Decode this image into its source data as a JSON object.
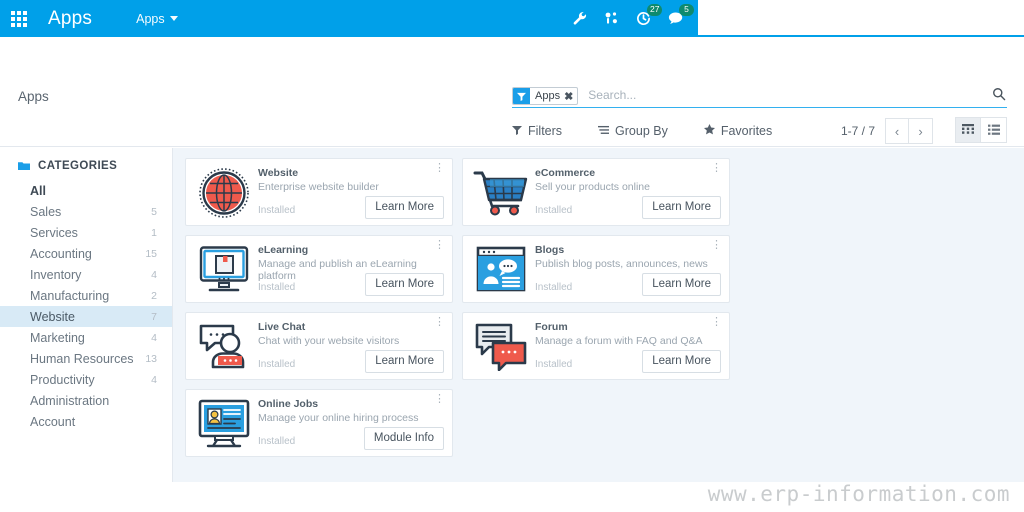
{
  "navbar": {
    "apps_grid_icon": "apps-grid-icon",
    "brand": "Apps",
    "menu_label": "Apps",
    "icons": [
      {
        "name": "wrench-icon",
        "badge": null
      },
      {
        "name": "settings-gear-icon",
        "badge": null
      },
      {
        "name": "activity-clock-icon",
        "badge": "27"
      },
      {
        "name": "messages-chat-icon",
        "badge": "5"
      }
    ]
  },
  "control": {
    "breadcrumb": "Apps",
    "search": {
      "facet_label": "Apps",
      "facet_remove": "✖",
      "placeholder": "Search...",
      "value": "",
      "search_icon": "search-icon"
    },
    "buttons": [
      {
        "label": "Filters",
        "icon": "filter-icon"
      },
      {
        "label": "Group By",
        "icon": "group-by-icon"
      },
      {
        "label": "Favorites",
        "icon": "star-icon"
      }
    ],
    "pager": {
      "count": "1-7 / 7",
      "prev": "‹",
      "next": "›"
    },
    "views": [
      {
        "name": "kanban-view",
        "icon": "grid-view-icon",
        "active": true
      },
      {
        "name": "list-view",
        "icon": "list-view-icon",
        "active": false
      }
    ]
  },
  "sidebar": {
    "heading": "CATEGORIES",
    "heading_icon": "folder-icon",
    "items": [
      {
        "label": "All",
        "count": "",
        "active": false,
        "bold": true
      },
      {
        "label": "Sales",
        "count": "5",
        "active": false,
        "bold": false
      },
      {
        "label": "Services",
        "count": "1",
        "active": false,
        "bold": false
      },
      {
        "label": "Accounting",
        "count": "15",
        "active": false,
        "bold": false
      },
      {
        "label": "Inventory",
        "count": "4",
        "active": false,
        "bold": false
      },
      {
        "label": "Manufacturing",
        "count": "2",
        "active": false,
        "bold": false
      },
      {
        "label": "Website",
        "count": "7",
        "active": true,
        "bold": false
      },
      {
        "label": "Marketing",
        "count": "4",
        "active": false,
        "bold": false
      },
      {
        "label": "Human Resources",
        "count": "13",
        "active": false,
        "bold": false
      },
      {
        "label": "Productivity",
        "count": "4",
        "active": false,
        "bold": false
      },
      {
        "label": "Administration",
        "count": "",
        "active": false,
        "bold": false
      },
      {
        "label": "Account",
        "count": "",
        "active": false,
        "bold": false
      }
    ]
  },
  "apps": [
    {
      "icon": "globe-icon",
      "title": "Website",
      "description": "Enterprise website builder",
      "state": "Installed",
      "button": "Learn More"
    },
    {
      "icon": "shopping-cart-icon",
      "title": "eCommerce",
      "description": "Sell your products online",
      "state": "Installed",
      "button": "Learn More"
    },
    {
      "icon": "monitor-book-icon",
      "title": "eLearning",
      "description": "Manage and publish an eLearning platform",
      "state": "Installed",
      "button": "Learn More"
    },
    {
      "icon": "browser-chat-icon",
      "title": "Blogs",
      "description": "Publish blog posts, announces, news",
      "state": "Installed",
      "button": "Learn More"
    },
    {
      "icon": "chat-person-icon",
      "title": "Live Chat",
      "description": "Chat with your website visitors",
      "state": "Installed",
      "button": "Learn More"
    },
    {
      "icon": "forum-bubbles-icon",
      "title": "Forum",
      "description": "Manage a forum with FAQ and Q&A",
      "state": "Installed",
      "button": "Learn More"
    },
    {
      "icon": "monitor-resume-icon",
      "title": "Online Jobs",
      "description": "Manage your online hiring process",
      "state": "Installed",
      "button": "Module Info"
    }
  ],
  "watermark": "www.erp-information.com",
  "colors": {
    "brand_blue": "#00A0E9",
    "badge_green": "#0e8a6e",
    "active_sidebar": "#d8eaf6",
    "content_bg": "#f0f5fa",
    "accent_red": "#ef5a4c"
  }
}
